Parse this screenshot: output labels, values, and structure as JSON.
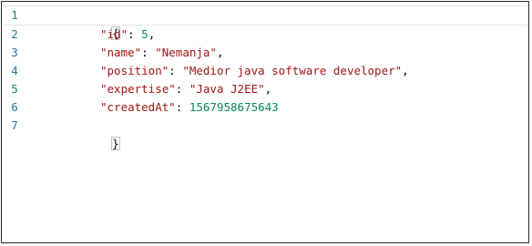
{
  "editor": {
    "lines": [
      {
        "n": "1",
        "brace": "{"
      },
      {
        "n": "2",
        "key": "\"id\"",
        "sep": ": ",
        "value": "5",
        "tail": ","
      },
      {
        "n": "3",
        "key": "\"name\"",
        "sep": ": ",
        "value": "\"Nemanja\"",
        "tail": ","
      },
      {
        "n": "4",
        "key": "\"position\"",
        "sep": ": ",
        "value": "\"Medior java software developer\"",
        "tail": ","
      },
      {
        "n": "5",
        "key": "\"expertise\"",
        "sep": ": ",
        "value": "\"Java J2EE\"",
        "tail": ","
      },
      {
        "n": "6",
        "key": "\"createdAt\"",
        "sep": ": ",
        "value": "1567958675643",
        "tail": ""
      },
      {
        "n": "7",
        "brace": "}"
      }
    ]
  },
  "colors": {
    "line_number": "#237893",
    "string": "#a31515",
    "number": "#098658"
  }
}
